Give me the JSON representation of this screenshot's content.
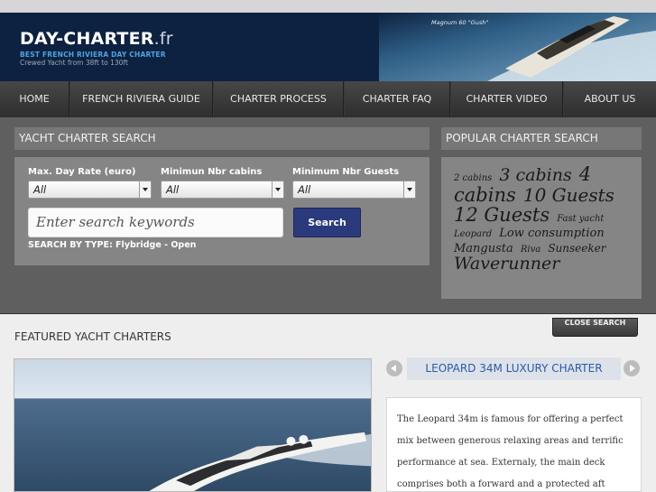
{
  "site": {
    "logo_main": "DAY-CHARTER",
    "logo_suffix": ".fr",
    "tagline": "BEST FRENCH RIVIERA DAY CHARTER",
    "subtagline": "Crewed Yacht from 38ft to 130ft",
    "photo_caption": "Magnum 60 \"Gush\""
  },
  "nav": {
    "items": [
      {
        "label": "HOME"
      },
      {
        "label": "FRENCH RIVIERA GUIDE"
      },
      {
        "label": "CHARTER PROCESS"
      },
      {
        "label": "CHARTER FAQ"
      },
      {
        "label": "CHARTER VIDEO"
      },
      {
        "label": "ABOUT US"
      }
    ]
  },
  "search": {
    "title": "YACHT CHARTER SEARCH",
    "day_rate_label": "Max. Day Rate (euro)",
    "day_rate_value": "All",
    "cabins_label": "Minimun Nbr cabins",
    "cabins_value": "All",
    "guests_label": "Minimum Nbr Guests",
    "guests_value": "All",
    "keyword_placeholder": "Enter search keywords",
    "button_label": "Search",
    "type_line": "SEARCH BY TYPE: Flybridge - Open"
  },
  "popular": {
    "title": "POPULAR CHARTER SEARCH",
    "tags": [
      {
        "label": "2 cabins",
        "size": 10
      },
      {
        "label": "3 cabins",
        "size": 19
      },
      {
        "label": "4 cabins",
        "size": 21
      },
      {
        "label": "10 Guests",
        "size": 20
      },
      {
        "label": "12 Guests",
        "size": 21
      },
      {
        "label": "Fast yacht",
        "size": 10
      },
      {
        "label": "Leopard",
        "size": 10
      },
      {
        "label": "Low consumption",
        "size": 13
      },
      {
        "label": "Mangusta",
        "size": 13
      },
      {
        "label": "Riva",
        "size": 10
      },
      {
        "label": "Sunseeker",
        "size": 12
      },
      {
        "label": "Waverunner",
        "size": 19
      }
    ]
  },
  "featured": {
    "close_label": "CLOSE SEARCH",
    "title": "FEATURED YACHT CHARTERS",
    "charter_name": "LEOPARD 34M LUXURY CHARTER",
    "description": "The Leopard 34m is famous for offering a perfect mix between generous relaxing areas and terrific performance at sea. Externaly, the main deck comprises both a forward and a protected aft"
  },
  "colors": {
    "header_bg": "#0d2240",
    "tagline": "#4fa3e0",
    "search_button": "#2a3a7c",
    "charter_name": "#2a59a8"
  }
}
